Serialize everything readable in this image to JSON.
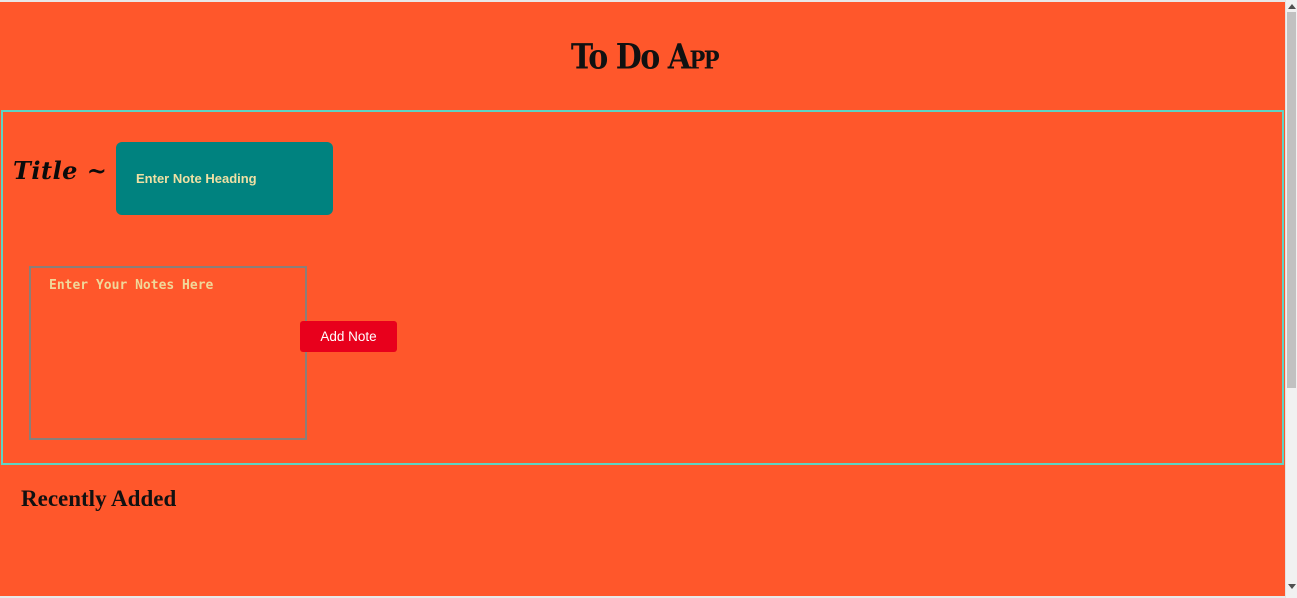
{
  "header": {
    "title_prefix": "To Do ",
    "title_suffix": "App"
  },
  "form": {
    "title_label": "Title ~",
    "heading_placeholder": "Enter Note Heading",
    "heading_value": "",
    "notes_placeholder": "Enter Your Notes Here",
    "notes_value": "",
    "add_button_label": "Add Note"
  },
  "recent": {
    "heading": "Recently Added",
    "items": []
  },
  "colors": {
    "page_background": "#ff572b",
    "form_border": "#5fd3c3",
    "heading_input_background": "#00827f",
    "placeholder_text": "#efe0a4",
    "button_background": "#e8001c",
    "button_text": "#ffffff"
  },
  "icons": {
    "scroll_up": "chevron-up-icon",
    "scroll_down": "chevron-down-icon"
  }
}
